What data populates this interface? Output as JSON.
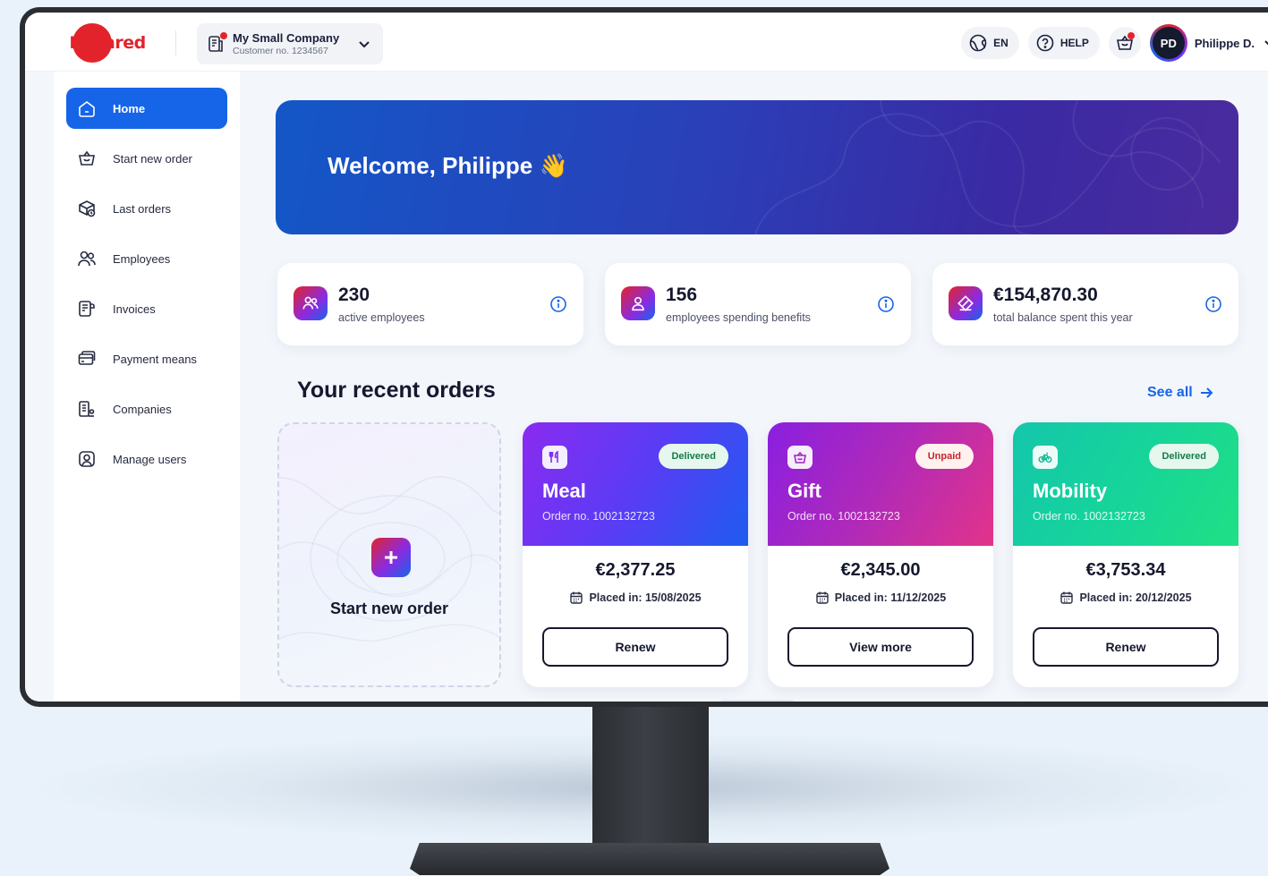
{
  "header": {
    "logo_text": "Edenred",
    "company": {
      "name": "My Small Company",
      "customer_no": "Customer no. 1234567"
    },
    "language": "EN",
    "help": "HELP",
    "user": {
      "initials": "PD",
      "name": "Philippe D."
    }
  },
  "sidebar": {
    "items": [
      {
        "label": "Home",
        "icon": "home-icon",
        "active": true
      },
      {
        "label": "Start new order",
        "icon": "basket-icon"
      },
      {
        "label": "Last orders",
        "icon": "box-clock-icon"
      },
      {
        "label": "Employees",
        "icon": "users-icon"
      },
      {
        "label": "Invoices",
        "icon": "invoice-icon"
      },
      {
        "label": "Payment means",
        "icon": "card-icon"
      },
      {
        "label": "Companies",
        "icon": "building-icon"
      },
      {
        "label": "Manage users",
        "icon": "user-manage-icon"
      }
    ]
  },
  "welcome": {
    "title": "Welcome, Philippe",
    "emoji": "👋"
  },
  "stats": [
    {
      "value": "230",
      "label": "active employees",
      "icon": "users-icon"
    },
    {
      "value": "156",
      "label": "employees spending benefits",
      "icon": "user-icon"
    },
    {
      "value": "€154,870.30",
      "label": "total balance spent this year",
      "icon": "ticket-icon"
    }
  ],
  "orders_section": {
    "title": "Your recent orders",
    "see_all": "See all",
    "new_order_label": "Start new order",
    "orders": [
      {
        "type": "Meal",
        "order_no": "Order no. 1002132723",
        "status": "Delivered",
        "amount": "€2,377.25",
        "placed": "Placed in: 15/08/2025",
        "action": "Renew",
        "icon": "cutlery-icon"
      },
      {
        "type": "Gift",
        "order_no": "Order no. 1002132723",
        "status": "Unpaid",
        "amount": "€2,345.00",
        "placed": "Placed in: 11/12/2025",
        "action": "View more",
        "icon": "gift-icon"
      },
      {
        "type": "Mobility",
        "order_no": "Order no. 1002132723",
        "status": "Delivered",
        "amount": "€3,753.34",
        "placed": "Placed in: 20/12/2025",
        "action": "Renew",
        "icon": "bike-icon"
      }
    ]
  },
  "colors": {
    "accent": "#1665e8",
    "brand_red": "#e3232b",
    "meal_gradient": [
      "#7b2ff7",
      "#1b57ef"
    ],
    "gift_gradient": [
      "#8a1fe0",
      "#e3338a"
    ],
    "mobility_gradient": [
      "#13c8a8",
      "#1ee088"
    ]
  }
}
